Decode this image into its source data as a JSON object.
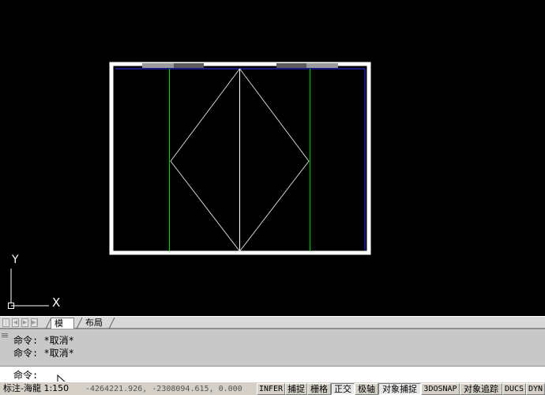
{
  "ucs_icon": {
    "y_label": "Y",
    "x_label": "X"
  },
  "layout_tabs": {
    "nav_buttons": [
      "first-tab",
      "previous-tab",
      "next-tab",
      "last-tab"
    ],
    "model": "模型",
    "layout": "布局",
    "active": "模型"
  },
  "command_history": [
    "命令: *取消*",
    "命令: *取消*"
  ],
  "command_prompt": "命令:",
  "status_bar": {
    "annotation_scale": "标注-海龍 1:150",
    "coordinates": "-4264221.926, -2308094.615, 0.000",
    "toggles": [
      {
        "label": "INFER",
        "on": false
      },
      {
        "label": "捕捉",
        "on": false
      },
      {
        "label": "栅格",
        "on": false
      },
      {
        "label": "正交",
        "on": true
      },
      {
        "label": "极轴",
        "on": false
      },
      {
        "label": "对象捕捉",
        "on": true
      },
      {
        "label": "3DOSNAP",
        "on": false
      },
      {
        "label": "对象追踪",
        "on": false
      },
      {
        "label": "DUCS",
        "on": false
      },
      {
        "label": "DYN",
        "on": false
      }
    ]
  },
  "colors": {
    "background": "#000000",
    "frame": "#ffffff",
    "top_edge": "#0000ff",
    "guide_lines": "#00ff00",
    "diamond": "#ffffff"
  }
}
